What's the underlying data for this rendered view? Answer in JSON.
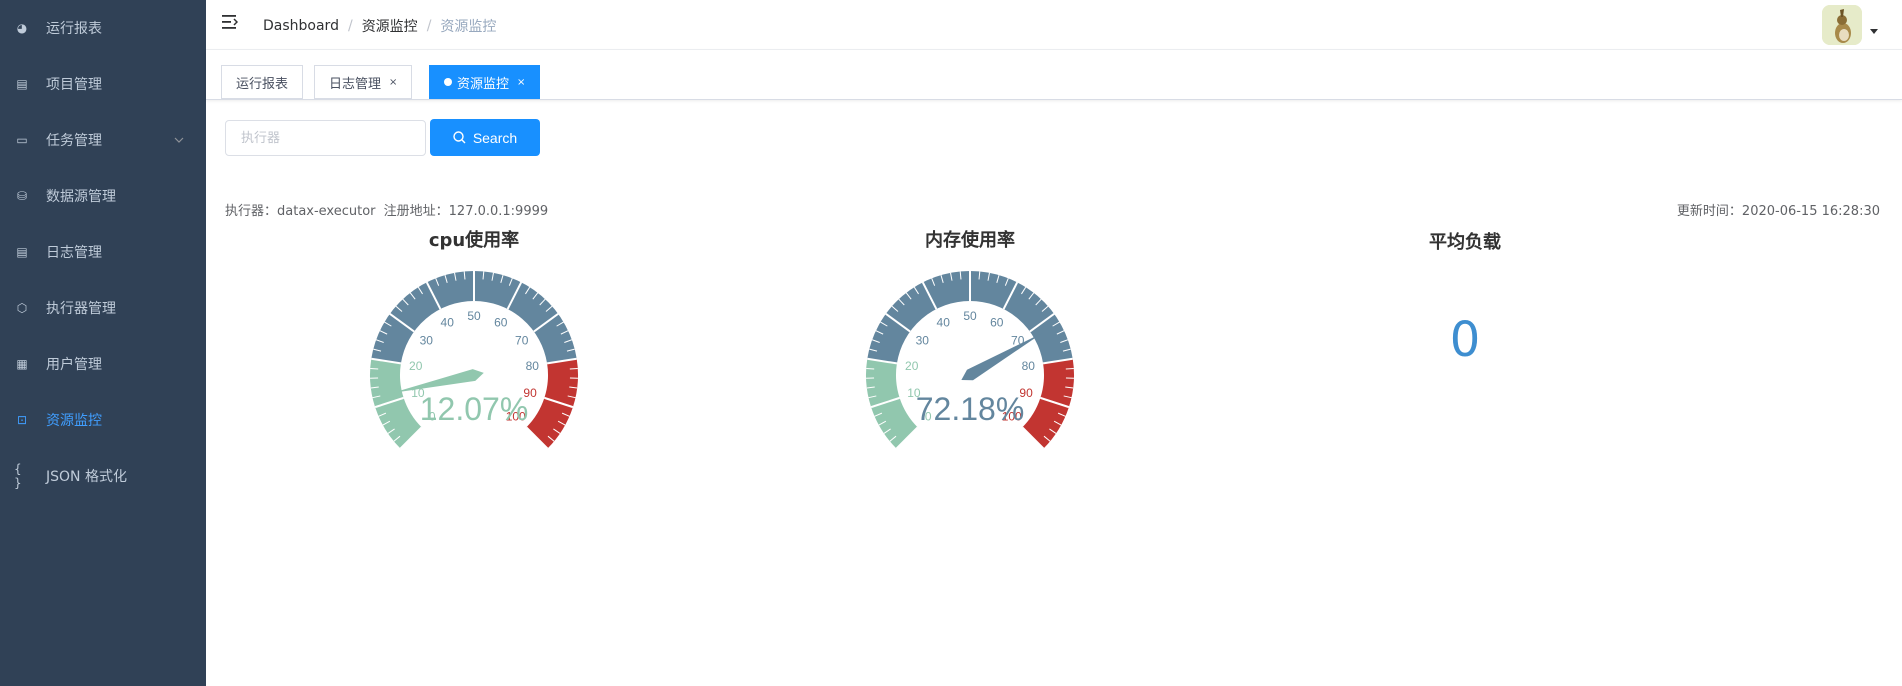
{
  "sidebar": {
    "items": [
      {
        "label": "运行报表",
        "icon": "dashboard-icon",
        "glyph": "◕"
      },
      {
        "label": "项目管理",
        "icon": "database-icon",
        "glyph": "▤"
      },
      {
        "label": "任务管理",
        "icon": "monitor-icon",
        "glyph": "▭",
        "expandable": true
      },
      {
        "label": "数据源管理",
        "icon": "datasource-icon",
        "glyph": "⛁"
      },
      {
        "label": "日志管理",
        "icon": "document-icon",
        "glyph": "▤"
      },
      {
        "label": "执行器管理",
        "icon": "cube-icon",
        "glyph": "⬡"
      },
      {
        "label": "用户管理",
        "icon": "table-icon",
        "glyph": "▦"
      },
      {
        "label": "资源监控",
        "icon": "monitor-link-icon",
        "glyph": "⊡",
        "active": true
      },
      {
        "label": "JSON 格式化",
        "icon": "braces-icon",
        "glyph": "{ }"
      }
    ]
  },
  "breadcrumb": [
    "Dashboard",
    "资源监控",
    "资源监控"
  ],
  "tags": [
    {
      "label": "运行报表",
      "closable": false
    },
    {
      "label": "日志管理",
      "closable": true
    },
    {
      "label": "资源监控",
      "closable": true,
      "active": true
    }
  ],
  "search": {
    "placeholder": "执行器",
    "button_label": "Search"
  },
  "info": {
    "executor_label": "执行器：datax-executor",
    "address_label": "注册地址：127.0.0.1:9999",
    "update_time": "更新时间：2020-06-15 16:28:30"
  },
  "chart_data": [
    {
      "type": "gauge",
      "title": "cpu使用率",
      "value": 12.07,
      "value_label": "12.07%",
      "min": 0,
      "max": 100,
      "ticks": [
        "0",
        "10",
        "20",
        "30",
        "40",
        "50",
        "60",
        "70",
        "80",
        "90",
        "100"
      ],
      "bands": [
        {
          "to": 0.2,
          "color": "#91c7ae"
        },
        {
          "to": 0.8,
          "color": "#63869e"
        },
        {
          "to": 1.0,
          "color": "#c23531"
        }
      ]
    },
    {
      "type": "gauge",
      "title": "内存使用率",
      "value": 72.18,
      "value_label": "72.18%",
      "min": 0,
      "max": 100,
      "ticks": [
        "0",
        "10",
        "20",
        "30",
        "40",
        "50",
        "60",
        "70",
        "80",
        "90",
        "100"
      ],
      "bands": [
        {
          "to": 0.2,
          "color": "#91c7ae"
        },
        {
          "to": 0.8,
          "color": "#63869e"
        },
        {
          "to": 1.0,
          "color": "#c23531"
        }
      ]
    }
  ],
  "load": {
    "title": "平均负载",
    "value": "0"
  },
  "colors": {
    "sidebar_bg": "#304156",
    "accent": "#1890ff",
    "active_menu": "#409eff"
  }
}
